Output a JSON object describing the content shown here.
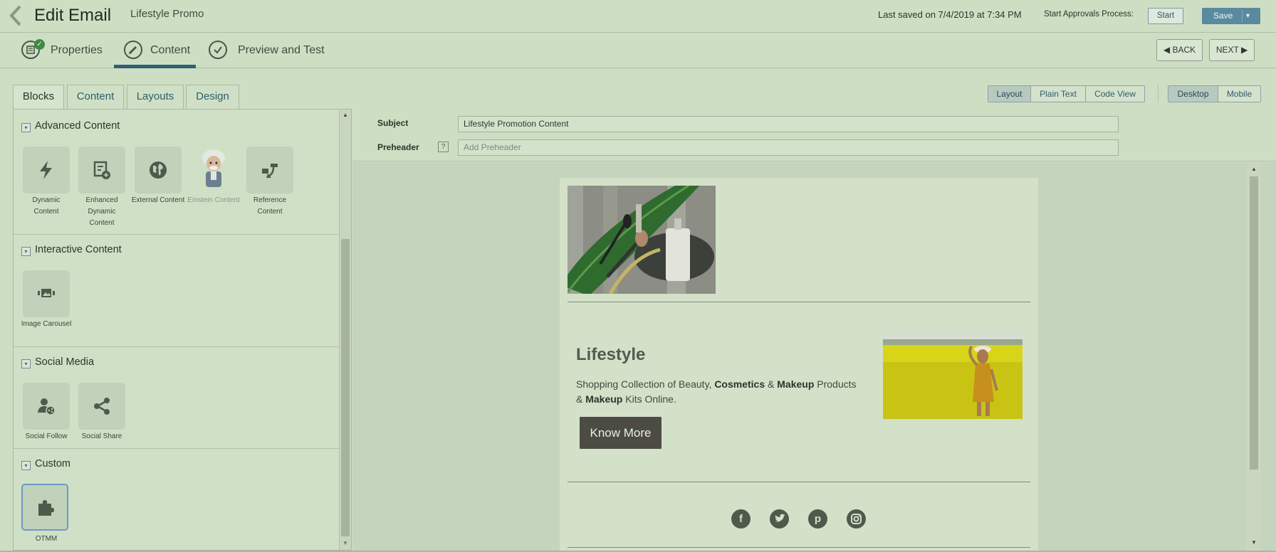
{
  "header": {
    "title": "Edit Email",
    "subtitle": "Lifestyle Promo",
    "last_saved": "Last saved on 7/4/2019 at 7:34 PM",
    "approvals_label": "Start Approvals Process:",
    "start_label": "Start",
    "save_label": "Save"
  },
  "steps": [
    {
      "label": "Properties",
      "completed": true
    },
    {
      "label": "Content",
      "active": true
    },
    {
      "label": "Preview and Test"
    }
  ],
  "nav": {
    "back_label": "BACK",
    "next_label": "NEXT"
  },
  "left_tabs": [
    "Blocks",
    "Content",
    "Layouts",
    "Design"
  ],
  "sections": {
    "advanced": {
      "title": "Advanced Content",
      "items": [
        {
          "label": "Dynamic Content",
          "icon": "bolt-icon"
        },
        {
          "label": "Enhanced Dynamic Content",
          "icon": "document-plus-icon"
        },
        {
          "label": "External Content",
          "icon": "globe-icon"
        },
        {
          "label": "Einstein Content",
          "icon": "einstein-icon",
          "disabled": true
        },
        {
          "label": "Reference Content",
          "icon": "reference-icon"
        }
      ]
    },
    "interactive": {
      "title": "Interactive Content",
      "items": [
        {
          "label": "Image Carousel",
          "icon": "image-carousel-icon"
        }
      ]
    },
    "social": {
      "title": "Social Media",
      "items": [
        {
          "label": "Social Follow",
          "icon": "social-follow-icon"
        },
        {
          "label": "Social Share",
          "icon": "share-icon"
        }
      ]
    },
    "custom": {
      "title": "Custom",
      "items": [
        {
          "label": "OTMM",
          "icon": "puzzle-icon",
          "selected": true
        }
      ]
    }
  },
  "view_modes": [
    "Layout",
    "Plain Text",
    "Code View"
  ],
  "device_modes": [
    "Desktop",
    "Mobile"
  ],
  "subject": {
    "label": "Subject",
    "value": "Lifestyle Promotion Content"
  },
  "preheader": {
    "label": "Preheader",
    "placeholder": "Add Preheader",
    "help": "?"
  },
  "email": {
    "heading": "Lifestyle",
    "desc_parts": [
      "Shopping Collection of Beauty, ",
      "Cosmetics",
      " & ",
      "Makeup",
      " Products",
      "& ",
      "Makeup",
      " Kits Online."
    ],
    "cta_label": "Know More",
    "social_icons": [
      "facebook-icon",
      "twitter-icon",
      "pinterest-icon",
      "instagram-icon"
    ]
  },
  "colors": {
    "accent": "#2f5f7a",
    "save_button": "#5a8aa0",
    "cta_button": "#4c4c44"
  }
}
